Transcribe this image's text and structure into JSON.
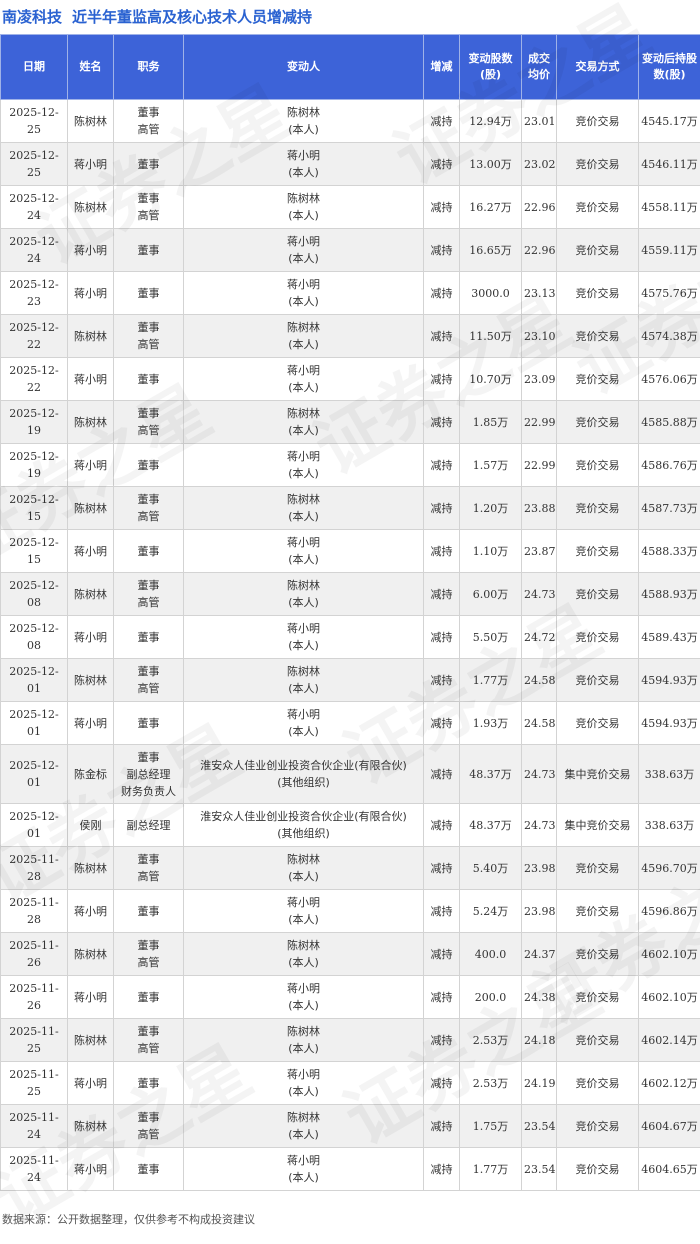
{
  "title": {
    "company": "南凌科技",
    "heading": "近半年董监高及核心技术人员增减持"
  },
  "columns": [
    "日期",
    "姓名",
    "职务",
    "变动人",
    "增减",
    "变动股数(股)",
    "成交均价",
    "交易方式",
    "变动后持股数(股)"
  ],
  "rows": [
    {
      "date": "2025-12-25",
      "name": "陈树林",
      "position": "董事\n高管",
      "changer": "陈树林\n(本人)",
      "direction": "减持",
      "change": "12.94万",
      "price": "23.01",
      "method": "竞价交易",
      "after": "4545.17万"
    },
    {
      "date": "2025-12-25",
      "name": "蒋小明",
      "position": "董事",
      "changer": "蒋小明\n(本人)",
      "direction": "减持",
      "change": "13.00万",
      "price": "23.02",
      "method": "竞价交易",
      "after": "4546.11万"
    },
    {
      "date": "2025-12-24",
      "name": "陈树林",
      "position": "董事\n高管",
      "changer": "陈树林\n(本人)",
      "direction": "减持",
      "change": "16.27万",
      "price": "22.96",
      "method": "竞价交易",
      "after": "4558.11万"
    },
    {
      "date": "2025-12-24",
      "name": "蒋小明",
      "position": "董事",
      "changer": "蒋小明\n(本人)",
      "direction": "减持",
      "change": "16.65万",
      "price": "22.96",
      "method": "竞价交易",
      "after": "4559.11万"
    },
    {
      "date": "2025-12-23",
      "name": "蒋小明",
      "position": "董事",
      "changer": "蒋小明\n(本人)",
      "direction": "减持",
      "change": "3000.0",
      "price": "23.13",
      "method": "竞价交易",
      "after": "4575.76万"
    },
    {
      "date": "2025-12-22",
      "name": "陈树林",
      "position": "董事\n高管",
      "changer": "陈树林\n(本人)",
      "direction": "减持",
      "change": "11.50万",
      "price": "23.10",
      "method": "竞价交易",
      "after": "4574.38万"
    },
    {
      "date": "2025-12-22",
      "name": "蒋小明",
      "position": "董事",
      "changer": "蒋小明\n(本人)",
      "direction": "减持",
      "change": "10.70万",
      "price": "23.09",
      "method": "竞价交易",
      "after": "4576.06万"
    },
    {
      "date": "2025-12-19",
      "name": "陈树林",
      "position": "董事\n高管",
      "changer": "陈树林\n(本人)",
      "direction": "减持",
      "change": "1.85万",
      "price": "22.99",
      "method": "竞价交易",
      "after": "4585.88万"
    },
    {
      "date": "2025-12-19",
      "name": "蒋小明",
      "position": "董事",
      "changer": "蒋小明\n(本人)",
      "direction": "减持",
      "change": "1.57万",
      "price": "22.99",
      "method": "竞价交易",
      "after": "4586.76万"
    },
    {
      "date": "2025-12-15",
      "name": "陈树林",
      "position": "董事\n高管",
      "changer": "陈树林\n(本人)",
      "direction": "减持",
      "change": "1.20万",
      "price": "23.88",
      "method": "竞价交易",
      "after": "4587.73万"
    },
    {
      "date": "2025-12-15",
      "name": "蒋小明",
      "position": "董事",
      "changer": "蒋小明\n(本人)",
      "direction": "减持",
      "change": "1.10万",
      "price": "23.87",
      "method": "竞价交易",
      "after": "4588.33万"
    },
    {
      "date": "2025-12-08",
      "name": "陈树林",
      "position": "董事\n高管",
      "changer": "陈树林\n(本人)",
      "direction": "减持",
      "change": "6.00万",
      "price": "24.73",
      "method": "竞价交易",
      "after": "4588.93万"
    },
    {
      "date": "2025-12-08",
      "name": "蒋小明",
      "position": "董事",
      "changer": "蒋小明\n(本人)",
      "direction": "减持",
      "change": "5.50万",
      "price": "24.72",
      "method": "竞价交易",
      "after": "4589.43万"
    },
    {
      "date": "2025-12-01",
      "name": "陈树林",
      "position": "董事\n高管",
      "changer": "陈树林\n(本人)",
      "direction": "减持",
      "change": "1.77万",
      "price": "24.58",
      "method": "竞价交易",
      "after": "4594.93万"
    },
    {
      "date": "2025-12-01",
      "name": "蒋小明",
      "position": "董事",
      "changer": "蒋小明\n(本人)",
      "direction": "减持",
      "change": "1.93万",
      "price": "24.58",
      "method": "竞价交易",
      "after": "4594.93万"
    },
    {
      "date": "2025-12-01",
      "name": "陈金标",
      "position": "董事\n副总经理\n财务负责人",
      "changer": "淮安众人佳业创业投资合伙企业(有限合伙)\n(其他组织)",
      "direction": "减持",
      "change": "48.37万",
      "price": "24.73",
      "method": "集中竞价交易",
      "after": "338.63万"
    },
    {
      "date": "2025-12-01",
      "name": "侯刚",
      "position": "副总经理",
      "changer": "淮安众人佳业创业投资合伙企业(有限合伙)\n(其他组织)",
      "direction": "减持",
      "change": "48.37万",
      "price": "24.73",
      "method": "集中竞价交易",
      "after": "338.63万"
    },
    {
      "date": "2025-11-28",
      "name": "陈树林",
      "position": "董事\n高管",
      "changer": "陈树林\n(本人)",
      "direction": "减持",
      "change": "5.40万",
      "price": "23.98",
      "method": "竞价交易",
      "after": "4596.70万"
    },
    {
      "date": "2025-11-28",
      "name": "蒋小明",
      "position": "董事",
      "changer": "蒋小明\n(本人)",
      "direction": "减持",
      "change": "5.24万",
      "price": "23.98",
      "method": "竞价交易",
      "after": "4596.86万"
    },
    {
      "date": "2025-11-26",
      "name": "陈树林",
      "position": "董事\n高管",
      "changer": "陈树林\n(本人)",
      "direction": "减持",
      "change": "400.0",
      "price": "24.37",
      "method": "竞价交易",
      "after": "4602.10万"
    },
    {
      "date": "2025-11-26",
      "name": "蒋小明",
      "position": "董事",
      "changer": "蒋小明\n(本人)",
      "direction": "减持",
      "change": "200.0",
      "price": "24.38",
      "method": "竞价交易",
      "after": "4602.10万"
    },
    {
      "date": "2025-11-25",
      "name": "陈树林",
      "position": "董事\n高管",
      "changer": "陈树林\n(本人)",
      "direction": "减持",
      "change": "2.53万",
      "price": "24.18",
      "method": "竞价交易",
      "after": "4602.14万"
    },
    {
      "date": "2025-11-25",
      "name": "蒋小明",
      "position": "董事",
      "changer": "蒋小明\n(本人)",
      "direction": "减持",
      "change": "2.53万",
      "price": "24.19",
      "method": "竞价交易",
      "after": "4602.12万"
    },
    {
      "date": "2025-11-24",
      "name": "陈树林",
      "position": "董事\n高管",
      "changer": "陈树林\n(本人)",
      "direction": "减持",
      "change": "1.75万",
      "price": "23.54",
      "method": "竞价交易",
      "after": "4604.67万"
    },
    {
      "date": "2025-11-24",
      "name": "蒋小明",
      "position": "董事",
      "changer": "蒋小明\n(本人)",
      "direction": "减持",
      "change": "1.77万",
      "price": "23.54",
      "method": "竞价交易",
      "after": "4604.65万"
    }
  ],
  "footer": "数据来源：公开数据整理，仅供参考不构成投资建议",
  "watermark": "证券之星",
  "colors": {
    "header_bg": "#3d63d8",
    "title_text": "#2a62d1",
    "decrease_text": "#1e9e3a",
    "alt_row_bg": "#f0f0f0"
  }
}
